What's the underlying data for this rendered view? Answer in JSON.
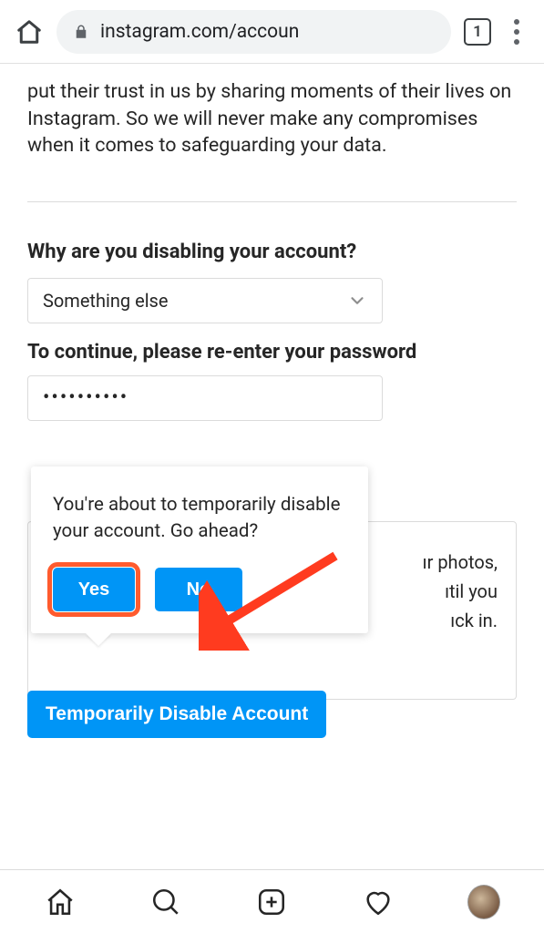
{
  "browser": {
    "url_display": "instagram.com/accoun",
    "tab_count": "1"
  },
  "page": {
    "intro_text": "put their trust in us by sharing moments of their lives on Instagram. So we will never make any compromises when it comes to safeguarding your data.",
    "question_label": "Why are you disabling your account?",
    "reason_selected": "Something else",
    "password_label": "To continue, please re-enter your password",
    "password_masked": "••••••••••",
    "confirm_dialog": {
      "message": "You're about to temporarily disable your account. Go ahead?",
      "yes_label": "Yes",
      "no_label": "No"
    },
    "background_panel": {
      "line1": "ır photos,",
      "line2": "ıtil you",
      "line3": "ıck in."
    },
    "disable_button_label": "Temporarily Disable Account"
  }
}
